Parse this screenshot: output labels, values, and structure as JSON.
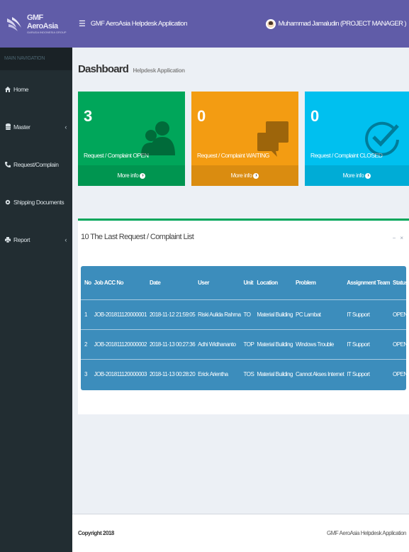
{
  "brand": {
    "name": "GMF AeroAsia",
    "tagline": "GARUDA INDONESIA GROUP"
  },
  "header": {
    "app_title": "GMF AeroAsia Helpdesk Application",
    "user": "Muhammad Jamaludin (PROJECT MANAGER )"
  },
  "sidebar": {
    "nav_header": "MAIN NAVIGATION",
    "items": [
      {
        "label": "Home",
        "icon": "home-icon"
      },
      {
        "label": "Master",
        "icon": "database-icon",
        "has_submenu": true
      },
      {
        "label": "Request/Complain",
        "icon": "phone-icon"
      },
      {
        "label": "Shipping Documents",
        "icon": "settings-icon"
      },
      {
        "label": "Report",
        "icon": "print-icon",
        "has_submenu": true
      }
    ]
  },
  "page": {
    "title": "Dashboard",
    "subtitle": "Helpdesk Application"
  },
  "stats": [
    {
      "count": "3",
      "label": "Request / Complaint OPEN",
      "more": "More info",
      "color": "#00a65a"
    },
    {
      "count": "0",
      "label": "Request / Complaint WAITING",
      "more": "More info",
      "color": "#f39c12"
    },
    {
      "count": "0",
      "label": "Request / Complaint CLOSED",
      "more": "More info",
      "color": "#00c0ef"
    }
  ],
  "list": {
    "title": "10 The Last Request / Complaint List",
    "columns": [
      "No",
      "Job ACC No",
      "Date",
      "User",
      "Unit",
      "Location",
      "Problem",
      "Assignment Team",
      "Status"
    ],
    "rows": [
      [
        "1",
        "JOB-201811120000001",
        "2018-11-12 21:59:05",
        "Riski Aulida Rahma",
        "TO",
        "Material Building",
        "PC Lambat",
        "IT Support",
        "OPEN"
      ],
      [
        "2",
        "JOB-201811120000002",
        "2018-11-13 00:27:36",
        "Adhi Widhananto",
        "TOP",
        "Material Building",
        "Windows Trouble",
        "IT Support",
        "OPEN"
      ],
      [
        "3",
        "JOB-201811120000003",
        "2018-11-13 00:28:20",
        "Erick Arientha",
        "TOS",
        "Material Building",
        "Cannot Akses Internet",
        "IT Support",
        "OPEN"
      ]
    ],
    "table_color": "#3c8dbc",
    "accent": "#00a65a"
  },
  "footer": {
    "copyright": "Copyright 2018",
    "app": "GMF AeroAsia Helpdesk Application"
  }
}
